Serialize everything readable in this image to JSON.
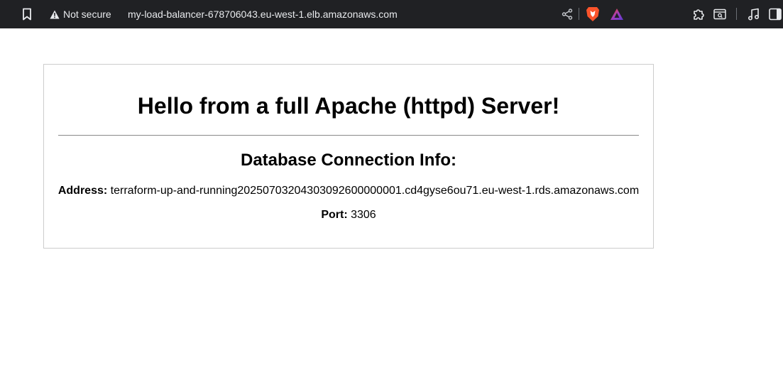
{
  "browser": {
    "security_label": "Not secure",
    "url": "my-load-balancer-678706043.eu-west-1.elb.amazonaws.com",
    "icons": [
      "bookmark-icon",
      "warning-icon",
      "share-icon",
      "brave-shields-icon",
      "brave-rewards-icon",
      "extensions-icon",
      "screenshot-icon",
      "media-icon",
      "sidebar-icon"
    ],
    "colors": {
      "toolbar_bg": "#202124",
      "brave_orange": "#fb542b",
      "rewards_purple": "#a23cbf"
    }
  },
  "page": {
    "heading": "Hello from a full Apache (httpd) Server!",
    "subheading": "Database Connection Info:",
    "address_label": "Address:",
    "address_value": "terraform-up-and-running20250703204303092600000001.cd4gyse6ou71.eu-west-1.rds.amazonaws.com",
    "port_label": "Port:",
    "port_value": "3306"
  }
}
